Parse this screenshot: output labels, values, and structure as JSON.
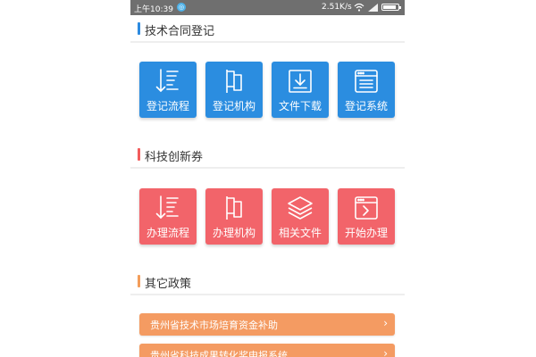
{
  "status_bar": {
    "time": "上午10:39",
    "net_speed": "2.51K/s",
    "bg_color": "#6f6f6f",
    "icons": [
      "app-notification-icon",
      "wifi-icon",
      "signal-icon",
      "battery-icon"
    ]
  },
  "sections": [
    {
      "title": "技术合同登记",
      "accent": "#2d8be0",
      "tiles": [
        {
          "label": "登记流程",
          "icon": "list-sort-icon"
        },
        {
          "label": "登记机构",
          "icon": "flag-icon"
        },
        {
          "label": "文件下载",
          "icon": "download-icon"
        },
        {
          "label": "登记系统",
          "icon": "window-list-icon"
        }
      ]
    },
    {
      "title": "科技创新券",
      "accent": "#f25c5c",
      "tiles": [
        {
          "label": "办理流程",
          "icon": "list-sort-icon"
        },
        {
          "label": "办理机构",
          "icon": "flag-icon"
        },
        {
          "label": "相关文件",
          "icon": "layers-icon"
        },
        {
          "label": "开始办理",
          "icon": "window-arrow-icon"
        }
      ]
    },
    {
      "title": "其它政策",
      "accent": "#f39d5a",
      "items": [
        {
          "label": "贵州省技术市场培育资金补助"
        },
        {
          "label": "贵州省科技成果转化奖申报系统"
        }
      ]
    }
  ],
  "colors": {
    "tile_blue": "#2b8de0",
    "tile_red": "#f2646a",
    "policy_orange": "#f49b62",
    "divider": "#eeeeee"
  }
}
